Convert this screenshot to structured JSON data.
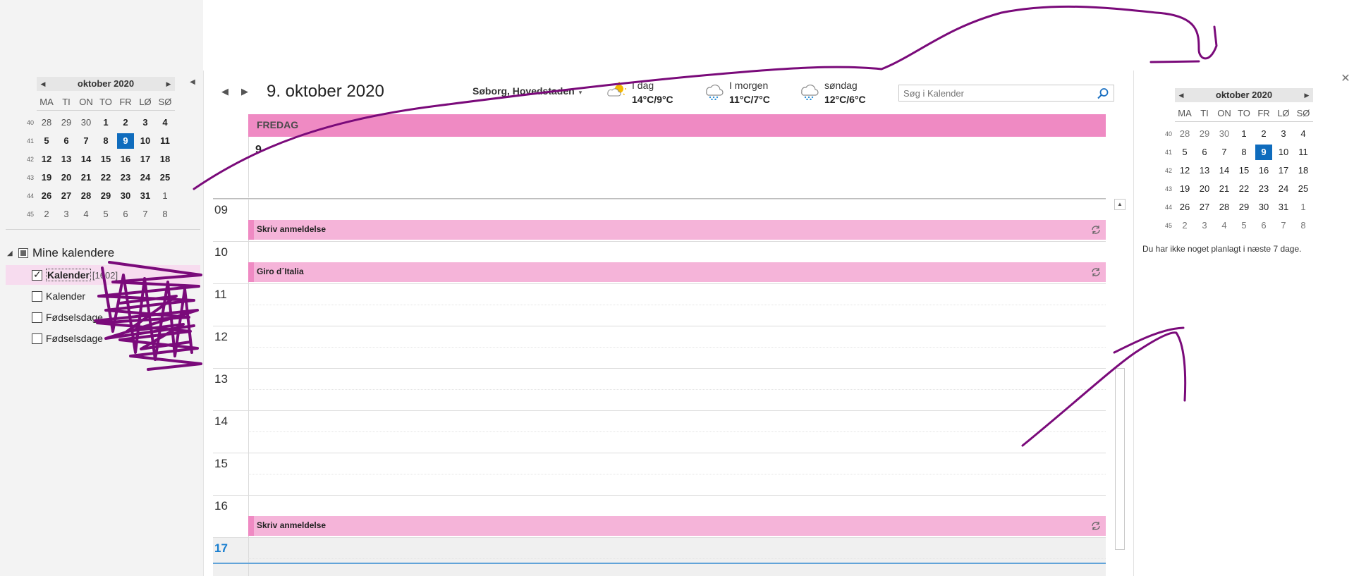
{
  "left_pane": {
    "mini_calendar": {
      "month_label": "oktober 2020",
      "prev_icon": "triangle-left-icon",
      "next_icon": "triangle-right-icon",
      "dow": [
        "MA",
        "TI",
        "ON",
        "TO",
        "FR",
        "LØ",
        "SØ"
      ],
      "weeks": [
        {
          "week": "40",
          "days": [
            "28",
            "29",
            "30",
            "1",
            "2",
            "3",
            "4"
          ]
        },
        {
          "week": "41",
          "days": [
            "5",
            "6",
            "7",
            "8",
            "9",
            "10",
            "11"
          ]
        },
        {
          "week": "42",
          "days": [
            "12",
            "13",
            "14",
            "15",
            "16",
            "17",
            "18"
          ]
        },
        {
          "week": "43",
          "days": [
            "19",
            "20",
            "21",
            "22",
            "23",
            "24",
            "25"
          ]
        },
        {
          "week": "44",
          "days": [
            "26",
            "27",
            "28",
            "29",
            "30",
            "31",
            "1"
          ]
        },
        {
          "week": "45",
          "days": [
            "2",
            "3",
            "4",
            "5",
            "6",
            "7",
            "8"
          ]
        }
      ],
      "today": "9"
    },
    "collapse_icon": "triangle-left-icon",
    "group_label": "Mine kalendere",
    "calendars": [
      {
        "label": "Kalender",
        "count": "[1602]",
        "checked": true,
        "selected": true
      },
      {
        "label": "Kalender",
        "count": "",
        "checked": false,
        "selected": false
      },
      {
        "label": "Fødselsdage",
        "count": "",
        "checked": false,
        "selected": false
      },
      {
        "label": "Fødselsdage",
        "count": "",
        "checked": false,
        "selected": false
      }
    ]
  },
  "header": {
    "prev_icon": "triangle-left-icon",
    "next_icon": "triangle-right-icon",
    "date_title": "9. oktober 2020",
    "location": "Søborg, Hovedstaden",
    "location_caret": "▾",
    "weather": [
      {
        "label": "I dag",
        "temp": "14°C/9°C",
        "icon": "partly-sunny-icon"
      },
      {
        "label": "I morgen",
        "temp": "11°C/7°C",
        "icon": "rain-cloud-icon"
      },
      {
        "label": "søndag",
        "temp": "12°C/6°C",
        "icon": "rain-cloud-icon"
      }
    ],
    "search_placeholder": "Søg i Kalender",
    "search_icon": "search-icon"
  },
  "day_view": {
    "day_name": "FREDAG",
    "day_number": "9",
    "hours": [
      "09",
      "10",
      "11",
      "12",
      "13",
      "14",
      "15",
      "16",
      "17"
    ],
    "events": [
      {
        "title": "Skriv anmeldelse",
        "start_hour": "09",
        "recurring": true
      },
      {
        "title": "Giro d´Italia",
        "start_hour": "10",
        "recurring": true
      },
      {
        "title": "Skriv anmeldelse",
        "start_hour": "16",
        "recurring": true
      }
    ]
  },
  "peek": {
    "close_icon": "close-icon",
    "mini_calendar": {
      "month_label": "oktober 2020",
      "dow": [
        "MA",
        "TI",
        "ON",
        "TO",
        "FR",
        "LØ",
        "SØ"
      ],
      "weeks": [
        {
          "week": "40",
          "days": [
            "28",
            "29",
            "30",
            "1",
            "2",
            "3",
            "4"
          ]
        },
        {
          "week": "41",
          "days": [
            "5",
            "6",
            "7",
            "8",
            "9",
            "10",
            "11"
          ]
        },
        {
          "week": "42",
          "days": [
            "12",
            "13",
            "14",
            "15",
            "16",
            "17",
            "18"
          ]
        },
        {
          "week": "43",
          "days": [
            "19",
            "20",
            "21",
            "22",
            "23",
            "24",
            "25"
          ]
        },
        {
          "week": "44",
          "days": [
            "26",
            "27",
            "28",
            "29",
            "30",
            "31",
            "1"
          ]
        },
        {
          "week": "45",
          "days": [
            "2",
            "3",
            "4",
            "5",
            "6",
            "7",
            "8"
          ]
        }
      ],
      "today": "9"
    },
    "agenda_message": "Du har ikke noget planlagt i næste 7 dage."
  },
  "colors": {
    "accent_pink": "#ef8ac3",
    "event_pink": "#f5b4d9",
    "today_blue": "#0f6cbd",
    "ink_purple": "#7a0a7a"
  }
}
